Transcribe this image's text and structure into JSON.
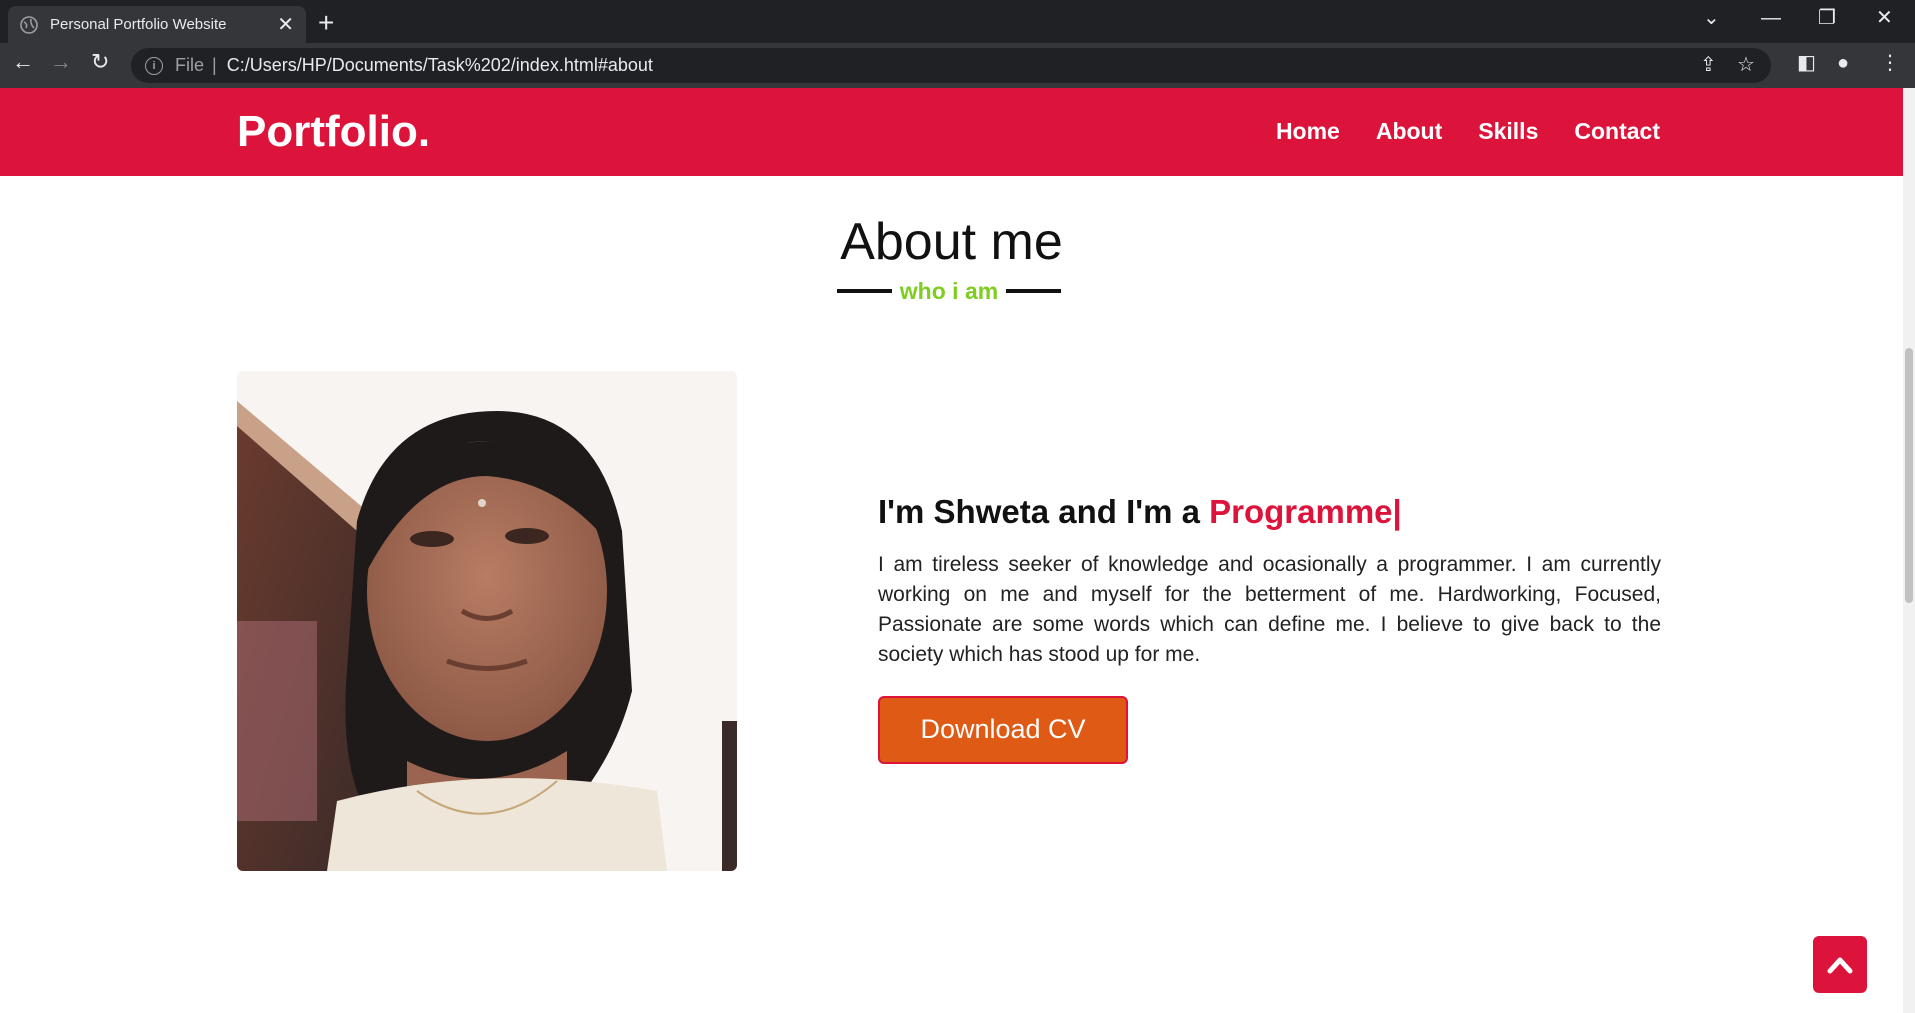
{
  "browser": {
    "tab_title": "Personal Portfolio Website",
    "file_label": "File",
    "url": "C:/Users/HP/Documents/Task%202/index.html#about"
  },
  "site": {
    "logo": "Portfolio.",
    "nav": [
      "Home",
      "About",
      "Skills",
      "Contact"
    ],
    "brand_color": "#dc143c",
    "accent_color": "#7fcd20",
    "button_color": "#df5a14"
  },
  "about": {
    "title": "About me",
    "subtitle": "who i am",
    "heading_prefix": "I'm Shweta and I'm a ",
    "heading_role": "Programme|",
    "text": "I am tireless seeker of knowledge and ocasionally a programmer. I am currently working on me and myself for the betterment of me. Hardworking, Focused, Passionate are some words which can define me. I believe to give back to the society which has stood up for me.",
    "button": "Download CV"
  }
}
